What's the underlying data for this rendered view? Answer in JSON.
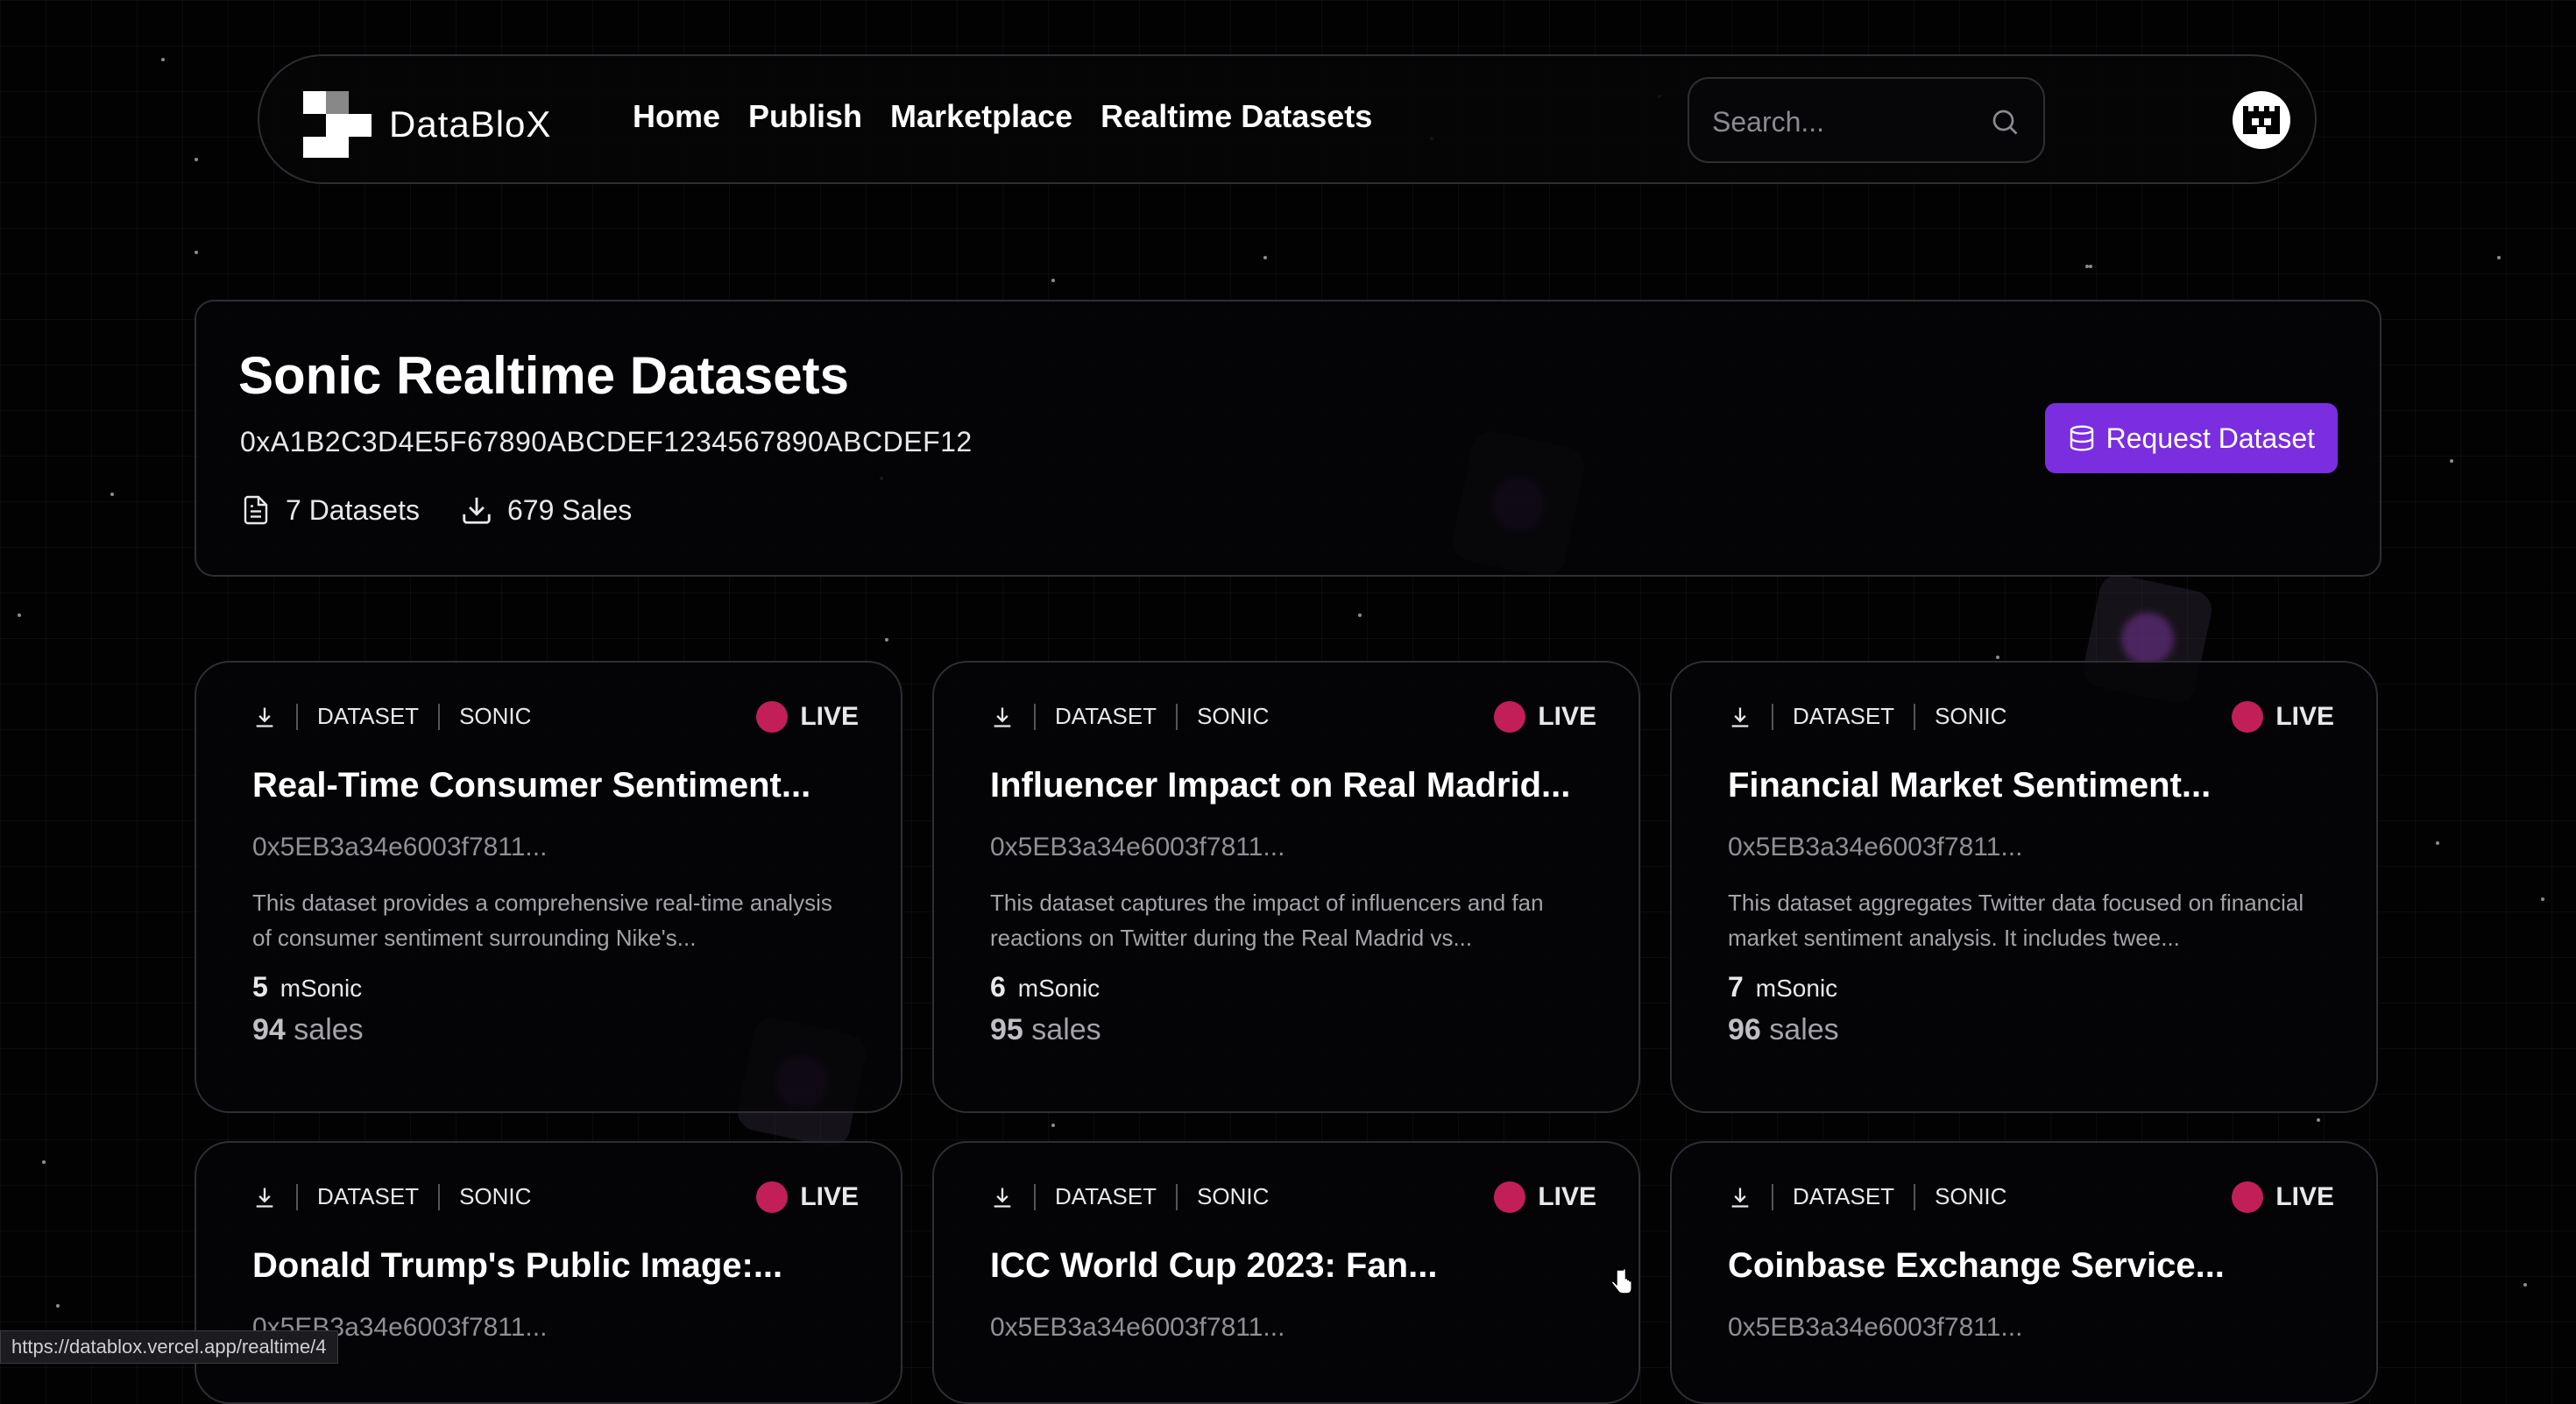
{
  "brand": {
    "name": "DataBloX"
  },
  "nav": {
    "links": [
      "Home",
      "Publish",
      "Marketplace",
      "Realtime Datasets"
    ]
  },
  "search": {
    "placeholder": "Search..."
  },
  "header": {
    "title": "Sonic Realtime Datasets",
    "address": "0xA1B2C3D4E5F67890ABCDEF1234567890ABCDEF12",
    "datasets_count": "7 Datasets",
    "sales_count": "679 Sales",
    "request_button": "Request Dataset"
  },
  "card_tags": {
    "type": "DATASET",
    "chain": "SONIC",
    "status": "LIVE"
  },
  "cards": [
    {
      "title": "Real-Time Consumer Sentiment...",
      "address": "0x5EB3a34e6003f7811...",
      "description": "This dataset provides a comprehensive real-time analysis of consumer sentiment surrounding Nike's...",
      "price": "5",
      "unit": "mSonic",
      "sales": "94",
      "sales_label": "sales"
    },
    {
      "title": "Influencer Impact on Real Madrid...",
      "address": "0x5EB3a34e6003f7811...",
      "description": "This dataset captures the impact of influencers and fan reactions on Twitter during the Real Madrid vs...",
      "price": "6",
      "unit": "mSonic",
      "sales": "95",
      "sales_label": "sales"
    },
    {
      "title": "Financial Market Sentiment...",
      "address": "0x5EB3a34e6003f7811...",
      "description": "This dataset aggregates Twitter data focused on financial market sentiment analysis. It includes twee...",
      "price": "7",
      "unit": "mSonic",
      "sales": "96",
      "sales_label": "sales"
    },
    {
      "title": "Donald Trump's Public Image:...",
      "address": "0x5EB3a34e6003f7811..."
    },
    {
      "title": "ICC World Cup 2023: Fan...",
      "address": "0x5EB3a34e6003f7811..."
    },
    {
      "title": "Coinbase Exchange Service...",
      "address": "0x5EB3a34e6003f7811..."
    }
  ],
  "status_bar": {
    "url": "https://datablox.vercel.app/realtime/4"
  },
  "colors": {
    "accent": "#7a2ee0",
    "live": "#c21f58",
    "background": "#020203"
  }
}
